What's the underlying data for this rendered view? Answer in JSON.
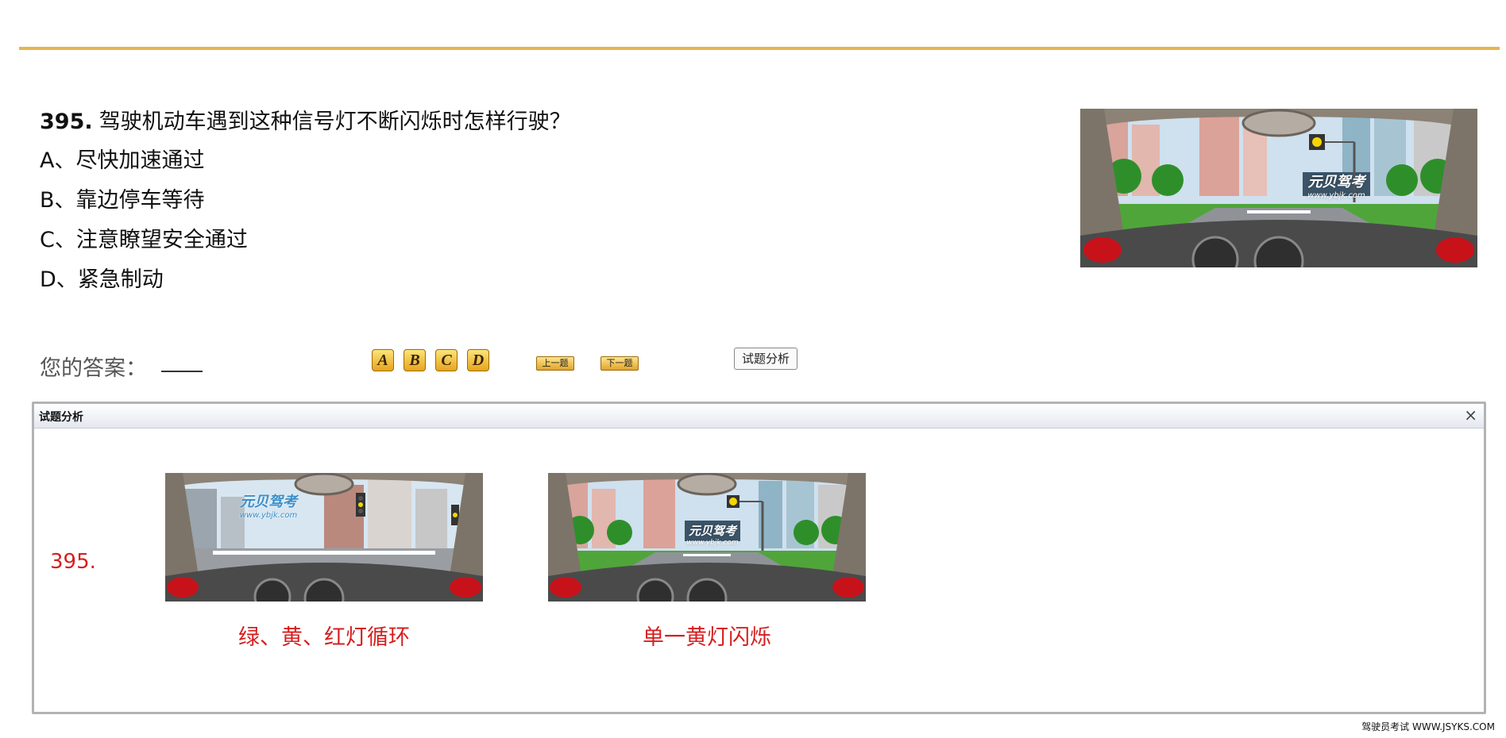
{
  "question": {
    "number": "395.",
    "text": "驾驶机动车遇到这种信号灯不断闪烁时怎样行驶？",
    "options": [
      "A、尽快加速通过",
      "B、靠边停车等待",
      "C、注意瞭望安全通过",
      "D、紧急制动"
    ],
    "image_watermark": {
      "line1": "元贝驾考",
      "line2": "www.ybjk.com"
    }
  },
  "answer": {
    "label": "您的答案：",
    "value": ""
  },
  "choice_buttons": [
    "A",
    "B",
    "C",
    "D"
  ],
  "nav": {
    "prev": "上一题",
    "next": "下一题",
    "analysis": "试题分析"
  },
  "analysis_panel": {
    "title": "试题分析",
    "close": "×",
    "number": "395.",
    "items": [
      {
        "caption": "绿、黄、红灯循环",
        "watermark": {
          "line1": "元贝驾考",
          "line2": "www.ybjk.com"
        }
      },
      {
        "caption": "单一黄灯闪烁",
        "watermark": {
          "line1": "元贝驾考",
          "line2": "www.ybjk.com"
        }
      }
    ]
  },
  "footer": "驾驶员考试 WWW.JSYKS.COM",
  "colors": {
    "accent_line": "#e5b64c",
    "analysis_text": "#d61f1f",
    "button_gold": "#e7a51c"
  },
  "icons": {
    "close": "close-icon"
  }
}
